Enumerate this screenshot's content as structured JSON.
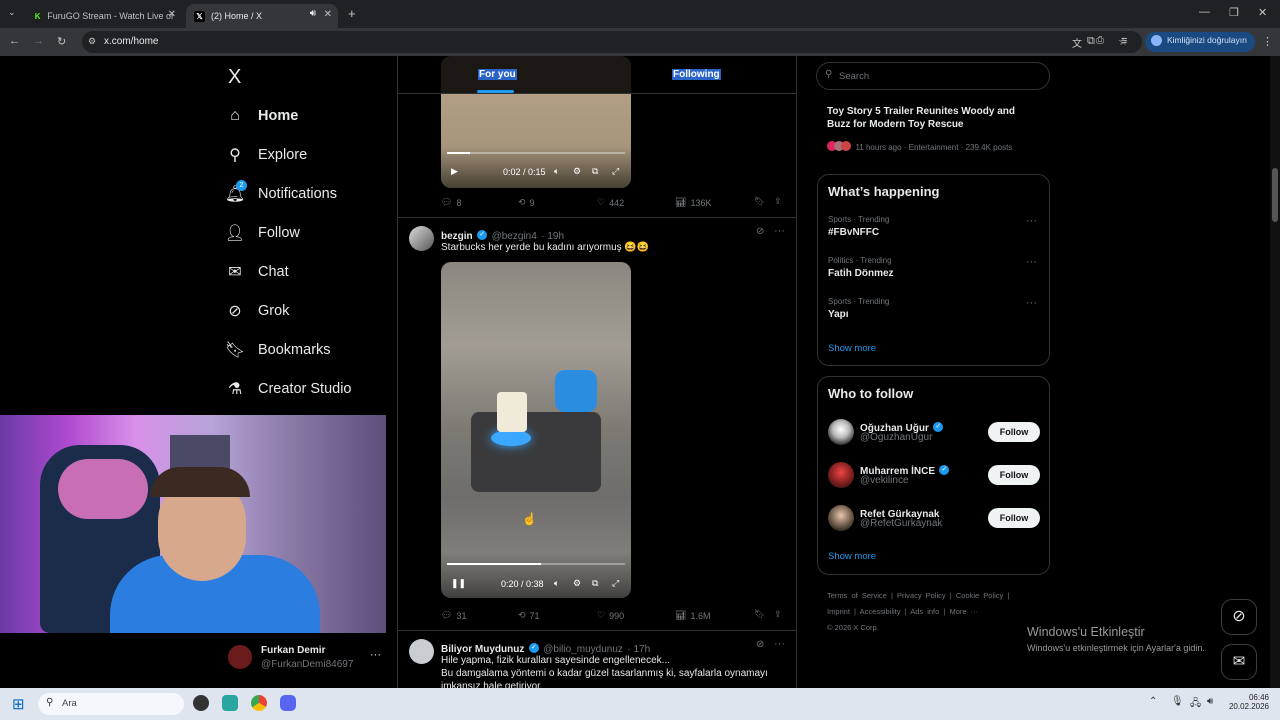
{
  "browser": {
    "tabs": [
      {
        "title": "FuruGO Stream - Watch Live or"
      },
      {
        "title": "(2) Home / X"
      }
    ],
    "url": "x.com/home",
    "verify_label": "Kimliğinizi doğrulayın"
  },
  "sidebar": {
    "logo": "X",
    "items": [
      {
        "label": "Home",
        "icon": "home-icon"
      },
      {
        "label": "Explore",
        "icon": "search-icon"
      },
      {
        "label": "Notifications",
        "icon": "bell-icon",
        "badge": "2"
      },
      {
        "label": "Follow",
        "icon": "person-add-icon"
      },
      {
        "label": "Chat",
        "icon": "mail-icon"
      },
      {
        "label": "Grok",
        "icon": "grok-icon"
      },
      {
        "label": "Bookmarks",
        "icon": "bookmark-icon"
      },
      {
        "label": "Creator Studio",
        "icon": "flask-icon"
      }
    ],
    "account": {
      "name": "Furkan Demir",
      "handle": "@FurkanDemi84697"
    }
  },
  "feed": {
    "tabs": [
      "For you",
      "Following"
    ],
    "tweet0": {
      "video_time": "0:02 / 0:15",
      "progress": 0.13,
      "stats": {
        "replies": "8",
        "reposts": "9",
        "likes": "442",
        "views": "136K"
      }
    },
    "tweet1": {
      "name": "bezgin",
      "handle": "@bezgin4",
      "time": "· 19h",
      "text": "Starbucks her yerde bu kadını arıyormuş 😆😆",
      "video_time": "0:20 / 0:38",
      "progress": 0.53,
      "stats": {
        "replies": "31",
        "reposts": "71",
        "likes": "990",
        "views": "1.6M"
      }
    },
    "tweet2": {
      "name": "Biliyor Muydunuz",
      "handle": "@bilio_muydunuz",
      "time": "· 17h",
      "line1": "Hile yapma, fizik kuralları sayesinde engellenecek...",
      "line2": "Bu damgalama yöntemi o kadar güzel tasarlanmış ki, sayfalarla oynamayı",
      "line3": "imkansız hale getiriyor."
    }
  },
  "right": {
    "search_placeholder": "Search",
    "news": {
      "title_line1": "Toy Story 5 Trailer Reunites Woody and",
      "title_line2": "Buzz for Modern Toy Rescue",
      "meta": "11 hours ago · Entertainment · 239.4K posts"
    },
    "happening": {
      "title": "What’s happening",
      "trends": [
        {
          "context": "Sports · Trending",
          "name": "#FBvNFFC"
        },
        {
          "context": "Politics · Trending",
          "name": "Fatih Dönmez"
        },
        {
          "context": "Sports · Trending",
          "name": "Yapı"
        }
      ],
      "show_more": "Show more"
    },
    "who_to_follow": {
      "title": "Who to follow",
      "users": [
        {
          "name": "Oğuzhan Uğur",
          "handle": "@OguzhanUgur",
          "button": "Follow"
        },
        {
          "name": "Muharrem İNCE",
          "handle": "@vekilince",
          "button": "Follow"
        },
        {
          "name": "Refet Gürkaynak",
          "handle": "@RefetGurkaynak",
          "button": "Follow"
        }
      ],
      "show_more": "Show more"
    },
    "footer": {
      "line1": [
        "Terms of Service",
        "|",
        "Privacy Policy",
        "|",
        "Cookie Policy",
        "|"
      ],
      "line2": [
        "Imprint",
        "|",
        "Accessibility",
        "|",
        "Ads info",
        "|",
        "More ···"
      ],
      "copyright": "© 2026 X Corp."
    }
  },
  "watermark": {
    "line1": "Windows'u Etkinleştir",
    "line2": "Windows'u etkinleştirmek için Ayarlar'a gidin."
  },
  "taskbar": {
    "search": "Ara",
    "time": "06:46",
    "date": "20.02.2026"
  }
}
